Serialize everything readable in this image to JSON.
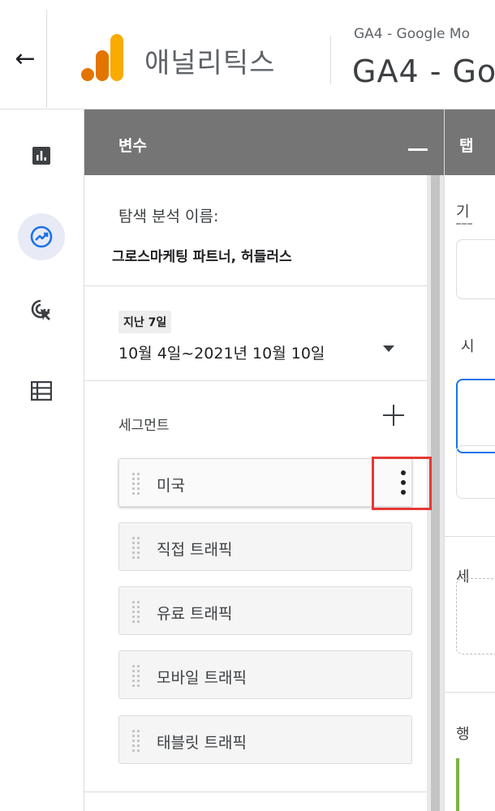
{
  "header": {
    "back_label": "←",
    "app_name": "애널리틱스",
    "property_small": "GA4 - Google Mo",
    "property_large": "GA4 - Go"
  },
  "rail": {
    "items": [
      {
        "icon": "bar-chart-icon",
        "active": false
      },
      {
        "icon": "explore-icon",
        "active": true
      },
      {
        "icon": "advertising-icon",
        "active": false
      },
      {
        "icon": "list-icon",
        "active": false
      }
    ]
  },
  "variables": {
    "title": "변수",
    "explore_name_label": "탐색 분석 이름:",
    "explore_name_value": "그로스마케팅 파트너, 허들러스",
    "date_chip": "지난 7일",
    "date_range": "10월 4일~2021년 10월 10일",
    "segments_label": "세그먼트",
    "segments": [
      {
        "label": "미국"
      },
      {
        "label": "직접 트래픽"
      },
      {
        "label": "유료 트래픽"
      },
      {
        "label": "모바일 트래픽"
      },
      {
        "label": "태블릿 트래픽"
      }
    ]
  },
  "tab_settings": {
    "title": "탭",
    "frag_1": "기",
    "frag_2": "시",
    "frag_3": "세",
    "frag_4": "행"
  },
  "colors": {
    "header_gray": "#757575",
    "highlight_red": "#e53935",
    "accent_blue": "#1a73e8",
    "logo_orange": "#f9ab00",
    "logo_dark_orange": "#e37400"
  }
}
